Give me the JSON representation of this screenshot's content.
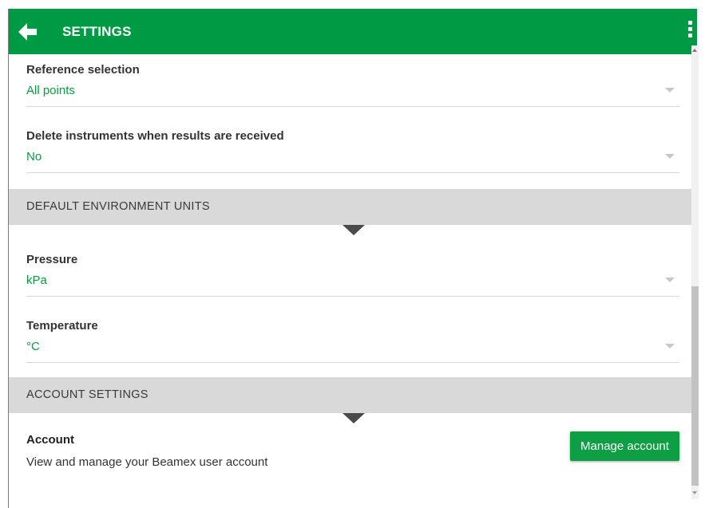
{
  "appbar": {
    "title": "SETTINGS",
    "back_icon": "arrow-left-icon",
    "menu_icon": "more-vertical-icon",
    "color": "#009a44"
  },
  "fields": [
    {
      "label": "Reference selection",
      "value": "All points"
    },
    {
      "label": "Delete instruments when results are received",
      "value": "No"
    },
    {
      "label": "Pressure",
      "value": "kPa"
    },
    {
      "label": "Temperature",
      "value": "°C"
    }
  ],
  "sections": {
    "environment": "DEFAULT ENVIRONMENT UNITS",
    "account": "ACCOUNT SETTINGS"
  },
  "account": {
    "title": "Account",
    "description": "View and manage your Beamex user account",
    "button_label": "Manage account"
  },
  "colors": {
    "accent": "#009a44",
    "value_text": "#0a9a3f",
    "section_bg": "#d9d9d9"
  }
}
